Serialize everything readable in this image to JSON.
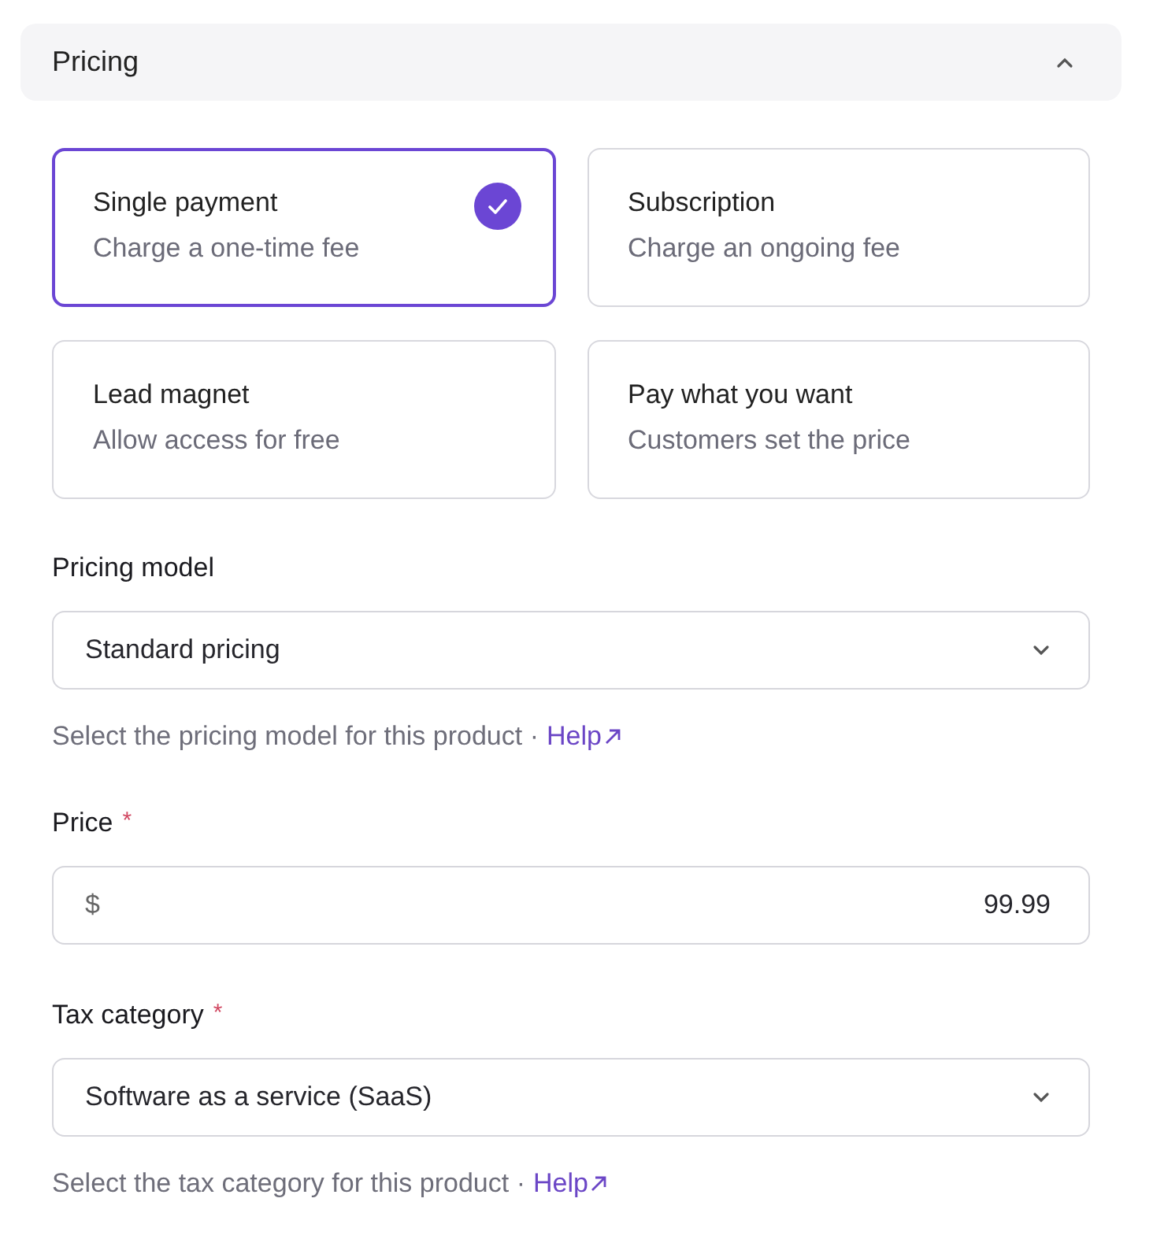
{
  "section": {
    "title": "Pricing",
    "expanded": true
  },
  "payment_options": [
    {
      "title": "Single payment",
      "description": "Charge a one-time fee",
      "selected": true
    },
    {
      "title": "Subscription",
      "description": "Charge an ongoing fee",
      "selected": false
    },
    {
      "title": "Lead magnet",
      "description": "Allow access for free",
      "selected": false
    },
    {
      "title": "Pay what you want",
      "description": "Customers set the price",
      "selected": false
    }
  ],
  "fields": [
    {
      "kind": "select",
      "label": "Pricing model",
      "value": "Standard pricing",
      "hint": "Select the pricing model for this product ·",
      "help_link": "Help"
    },
    {
      "kind": "money",
      "label": "Price",
      "required_mark": "*",
      "prefix": "$",
      "value": "99.99"
    },
    {
      "kind": "select",
      "label": "Tax category",
      "required_mark": "*",
      "value": "Software as a service (SaaS)",
      "hint": "Select the tax category for this product ·",
      "help_link": "Help"
    }
  ]
}
